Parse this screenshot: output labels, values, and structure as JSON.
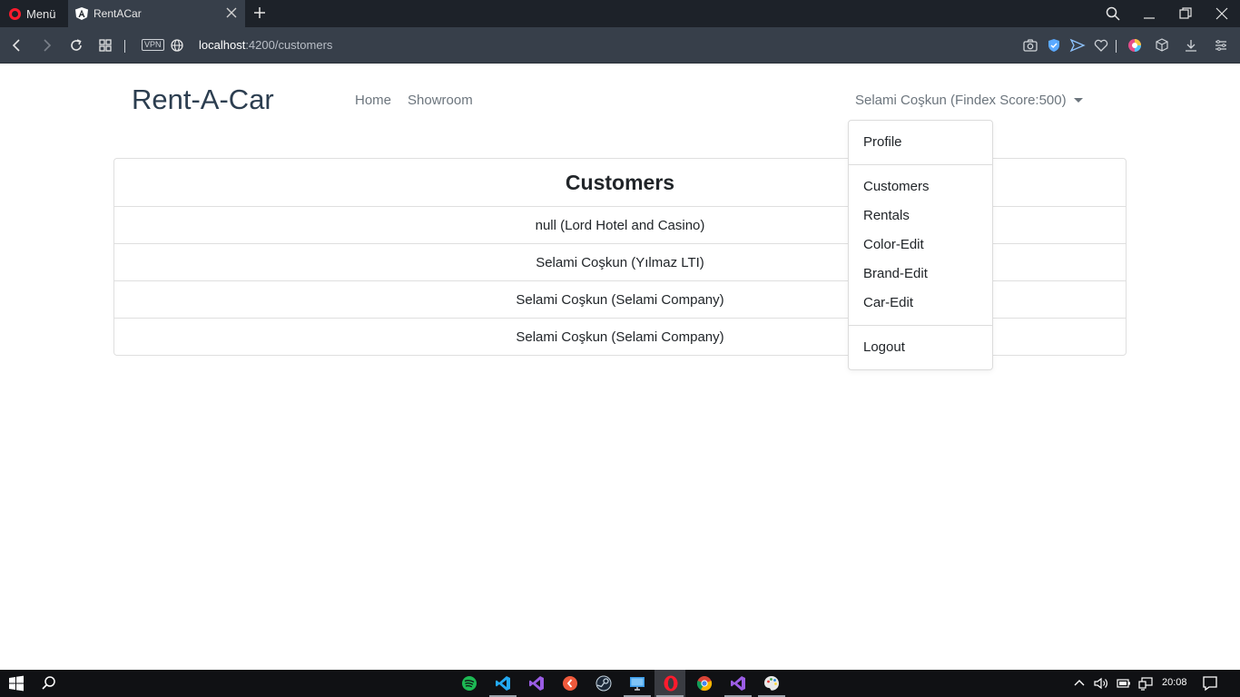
{
  "browser": {
    "menu_label": "Menü",
    "tab_title": "RentACar",
    "vpn_label": "VPN",
    "url_host": "localhost",
    "url_path": ":4200/customers"
  },
  "navbar": {
    "brand": "Rent-A-Car",
    "links": [
      "Home",
      "Showroom"
    ],
    "user_label": "Selami Coşkun (Findex Score:500)"
  },
  "dropdown": {
    "profile": "Profile",
    "items": [
      "Customers",
      "Rentals",
      "Color-Edit",
      "Brand-Edit",
      "Car-Edit"
    ],
    "logout": "Logout"
  },
  "customers": {
    "title": "Customers",
    "rows": [
      "null (Lord Hotel and Casino)",
      "Selami Coşkun (Yılmaz LTI)",
      "Selami Coşkun (Selami Company)",
      "Selami Coşkun (Selami Company)"
    ]
  },
  "taskbar": {
    "time": "20:08",
    "apps": [
      "spotify-icon",
      "vscode-icon",
      "visual-studio-icon",
      "git-icon",
      "steam-icon",
      "monitor-icon",
      "opera-icon",
      "chrome-icon",
      "visual-studio-icon",
      "paint-icon"
    ]
  },
  "colors": {
    "brand": "#2c3e50",
    "chrome_dark": "#1d2229",
    "chrome_mid": "#373f4a",
    "taskbar": "#101114"
  }
}
